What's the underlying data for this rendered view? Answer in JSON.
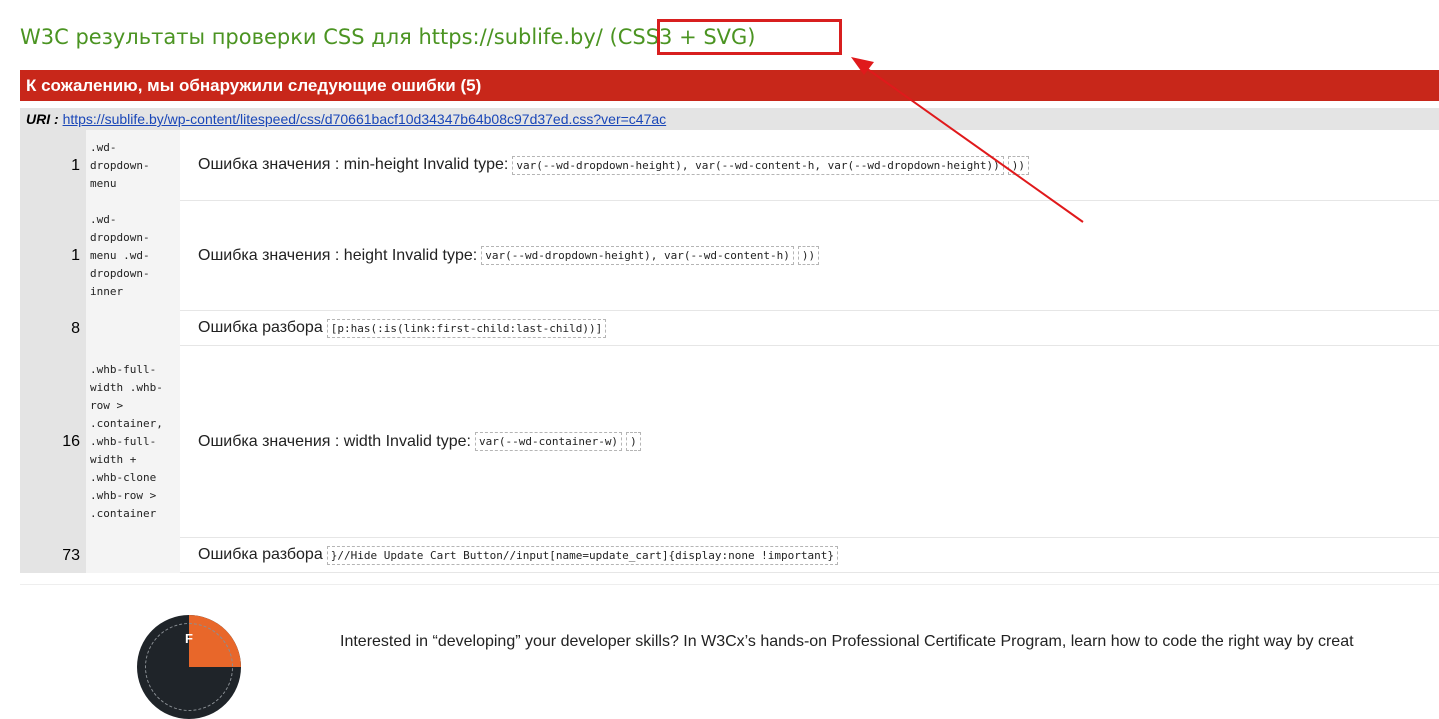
{
  "page": {
    "title_prefix": "W3C результаты проверки CSS для https://sublife.by/",
    "title_profile": " (CSS3 + SVG)"
  },
  "errors_section": {
    "header": "К сожалению, мы обнаружили следующие ошибки (5)",
    "uri_label": "URI :",
    "uri": "https://sublife.by/wp-content/litespeed/css/d70661bacf10d34347b64b08c97d37ed.css?ver=c47ac",
    "rows": [
      {
        "line": "1",
        "context": ".wd-dropdown-menu",
        "message": "Ошибка значения : min-height Invalid type:",
        "code1": "var(--wd-dropdown-height), var(--wd-content-h, var(--wd-dropdown-height))",
        "code2": "))"
      },
      {
        "line": "1",
        "context": ".wd-dropdown-menu .wd-dropdown-inner",
        "message": "Ошибка значения : height Invalid type:",
        "code1": "var(--wd-dropdown-height), var(--wd-content-h)",
        "code2": "))"
      },
      {
        "line": "8",
        "context": "",
        "message": "Ошибка разбора",
        "code1": "[p:has(:is(link:first-child:last-child))]",
        "code2": ""
      },
      {
        "line": "16",
        "context": ".whb-full-width .whb-row > .container, .whb-full-width + .whb-clone .whb-row > .container",
        "message": "Ошибка значения : width Invalid type:",
        "code1": "var(--wd-container-w)",
        "code2": ")"
      },
      {
        "line": "73",
        "context": "",
        "message": "Ошибка разбора",
        "code1": "}//Hide Update Cart Button//input[name=update_cart]{display:none !important}",
        "code2": ""
      }
    ]
  },
  "promo": {
    "text": "Interested in “developing” your developer skills? In W3Cx’s hands-on Professional Certificate Program, learn how to code the right way by creat",
    "badge_letter": "F"
  },
  "annotations": {
    "color": "#e0191b",
    "arrow_icon": "arrow-icon"
  },
  "colors": {
    "title_green": "#4b9422",
    "error_red": "#c8271a",
    "link_blue": "#1a47b8"
  }
}
